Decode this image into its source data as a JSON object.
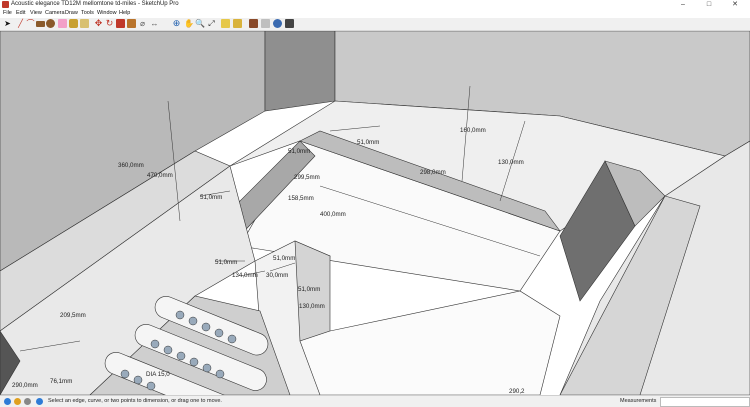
{
  "window": {
    "title": "Acoustic elegance TD12M mellomtone td-miles - SketchUp Pro",
    "minimize": "–",
    "maximize": "□",
    "close": "✕"
  },
  "menu": [
    "File",
    "Edit",
    "View",
    "Camera",
    "Draw",
    "Tools",
    "Window",
    "Help"
  ],
  "toolbar": {
    "icons": [
      "select-icon",
      "line-icon",
      "arc-icon",
      "rectangle-icon",
      "circle-icon",
      "eraser-icon",
      "paint-bucket-icon",
      "push-pull-icon",
      "move-icon",
      "rotate-icon",
      "scale-icon",
      "offset-icon",
      "tape-measure-icon",
      "dimension-icon",
      "orbit-icon",
      "pan-icon",
      "zoom-icon",
      "zoom-extents-icon",
      "3d-warehouse-icon",
      "components-icon",
      "extension-warehouse-icon",
      "layout-icon",
      "styles-icon",
      "shadows-icon"
    ]
  },
  "viewport": {
    "dimensions": [
      "360,0mm",
      "470,0mm",
      "51,0mm",
      "51,0mm",
      "298,0mm",
      "130,0mm",
      "160,0mm",
      "51,0mm",
      "299,5mm",
      "158,5mm",
      "400,0mm",
      "51,0mm",
      "51,0mm",
      "134,0mm",
      "30,0mm",
      "51,0mm",
      "130,0mm",
      "209,5mm",
      "290,0mm",
      "76,1mm",
      "DIA 15,0",
      "290,2"
    ]
  },
  "status": {
    "message": "Select an edge, curve, or two points to dimension, or drag one to move.",
    "measurements_label": "Measurements",
    "measurements_value": ""
  },
  "colors": {
    "wall_dark": "#b5b5b5",
    "wall_mid": "#d2d2d2",
    "wall_light": "#e6e6e6",
    "top_face": "#f4f4f4",
    "shadow_face": "#7a7a7a"
  }
}
